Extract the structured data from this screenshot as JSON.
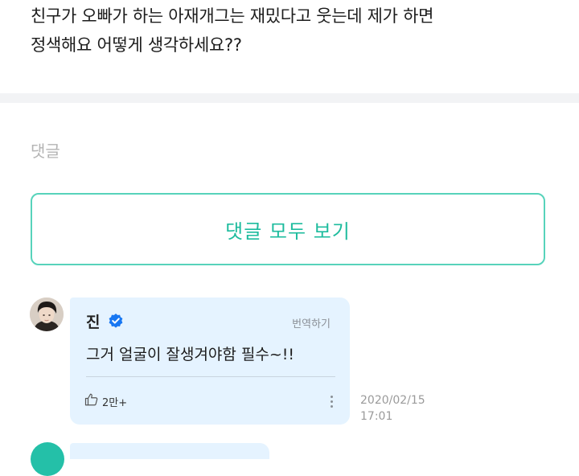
{
  "question": {
    "line1": "친구가 오빠가 하는 아재개그는 재밌다고 웃는데 제가 하면",
    "line2": "정색해요 어떻게 생각하세요??"
  },
  "comments_section": {
    "label": "댓글",
    "view_all_label": "댓글 모두 보기"
  },
  "comment": {
    "author": "진",
    "verified": true,
    "translate_label": "번역하기",
    "text": "그거 얼굴이 잘생겨야함 필수~!!",
    "likes": "2만+",
    "date": "2020/02/15",
    "time": "17:01"
  },
  "icons": {
    "verified": "verified-badge-icon",
    "like": "thumbs-up-icon",
    "more": "more-vertical-icon"
  },
  "colors": {
    "accent": "#1ebc9e",
    "accent_border": "#57d3bb",
    "bubble": "#e5f3ff",
    "verified": "#1877f2",
    "muted": "#b4b4b4"
  }
}
